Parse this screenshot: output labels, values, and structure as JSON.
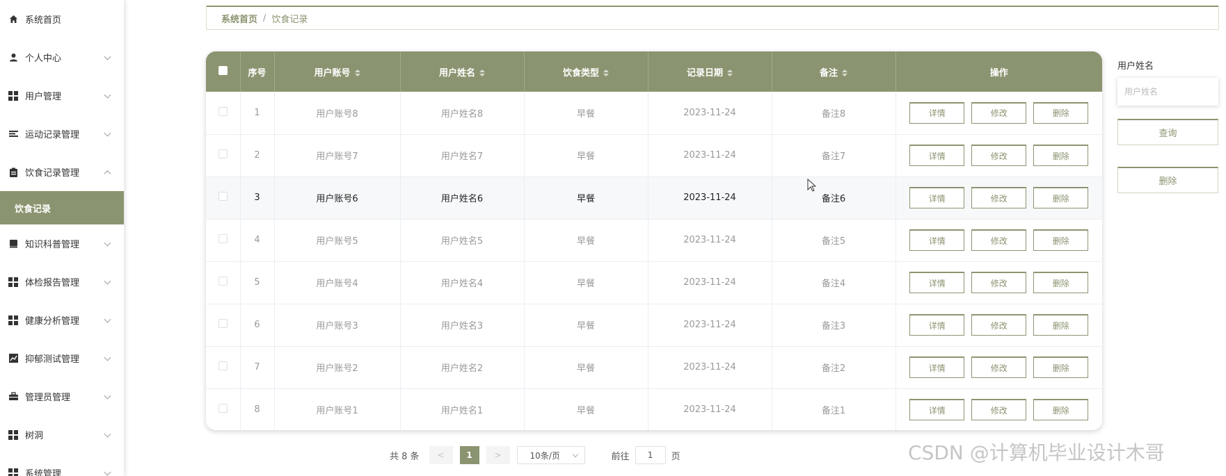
{
  "sidebar": {
    "items": [
      {
        "label": "系统首页",
        "icon": "home-icon"
      },
      {
        "label": "个人中心",
        "icon": "user-icon"
      },
      {
        "label": "用户管理",
        "icon": "grid-icon"
      },
      {
        "label": "运动记录管理",
        "icon": "list-icon"
      },
      {
        "label": "饮食记录管理",
        "icon": "clipboard-icon"
      }
    ],
    "active_sub": "饮食记录",
    "items_after": [
      {
        "label": "知识科普管理",
        "icon": "book-icon"
      },
      {
        "label": "体检报告管理",
        "icon": "grid-icon"
      },
      {
        "label": "健康分析管理",
        "icon": "grid-icon"
      },
      {
        "label": "抑郁测试管理",
        "icon": "chart-icon"
      },
      {
        "label": "管理员管理",
        "icon": "briefcase-icon"
      },
      {
        "label": "树洞",
        "icon": "grid-icon"
      },
      {
        "label": "系统管理",
        "icon": "grid-icon"
      }
    ]
  },
  "breadcrumb": {
    "home": "系统首页",
    "separator": "/",
    "current": "饮食记录"
  },
  "table": {
    "headers": [
      "序号",
      "用户账号",
      "用户姓名",
      "饮食类型",
      "记录日期",
      "备注",
      "操作"
    ],
    "rows": [
      {
        "idx": "1",
        "account": "用户账号8",
        "name": "用户姓名8",
        "type": "早餐",
        "date": "2023-11-24",
        "note": "备注8"
      },
      {
        "idx": "2",
        "account": "用户账号7",
        "name": "用户姓名7",
        "type": "早餐",
        "date": "2023-11-24",
        "note": "备注7"
      },
      {
        "idx": "3",
        "account": "用户账号6",
        "name": "用户姓名6",
        "type": "早餐",
        "date": "2023-11-24",
        "note": "备注6"
      },
      {
        "idx": "4",
        "account": "用户账号5",
        "name": "用户姓名5",
        "type": "早餐",
        "date": "2023-11-24",
        "note": "备注5"
      },
      {
        "idx": "5",
        "account": "用户账号4",
        "name": "用户姓名4",
        "type": "早餐",
        "date": "2023-11-24",
        "note": "备注4"
      },
      {
        "idx": "6",
        "account": "用户账号3",
        "name": "用户姓名3",
        "type": "早餐",
        "date": "2023-11-24",
        "note": "备注3"
      },
      {
        "idx": "7",
        "account": "用户账号2",
        "name": "用户姓名2",
        "type": "早餐",
        "date": "2023-11-24",
        "note": "备注2"
      },
      {
        "idx": "8",
        "account": "用户账号1",
        "name": "用户姓名1",
        "type": "早餐",
        "date": "2023-11-24",
        "note": "备注1"
      }
    ],
    "ops": {
      "detail": "详情",
      "edit": "修改",
      "delete": "删除"
    }
  },
  "search": {
    "label": "用户姓名",
    "placeholder": "用户姓名",
    "query_btn": "查询",
    "delete_btn": "删除"
  },
  "pagination": {
    "total": "共 8 条",
    "prev": "<",
    "current": "1",
    "next": ">",
    "page_size": "10条/页",
    "goto_label": "前往",
    "goto_value": "1",
    "page_suffix": "页"
  },
  "watermark": "CSDN @计算机毕业设计木哥",
  "colors": {
    "accent": "#8b9470"
  }
}
